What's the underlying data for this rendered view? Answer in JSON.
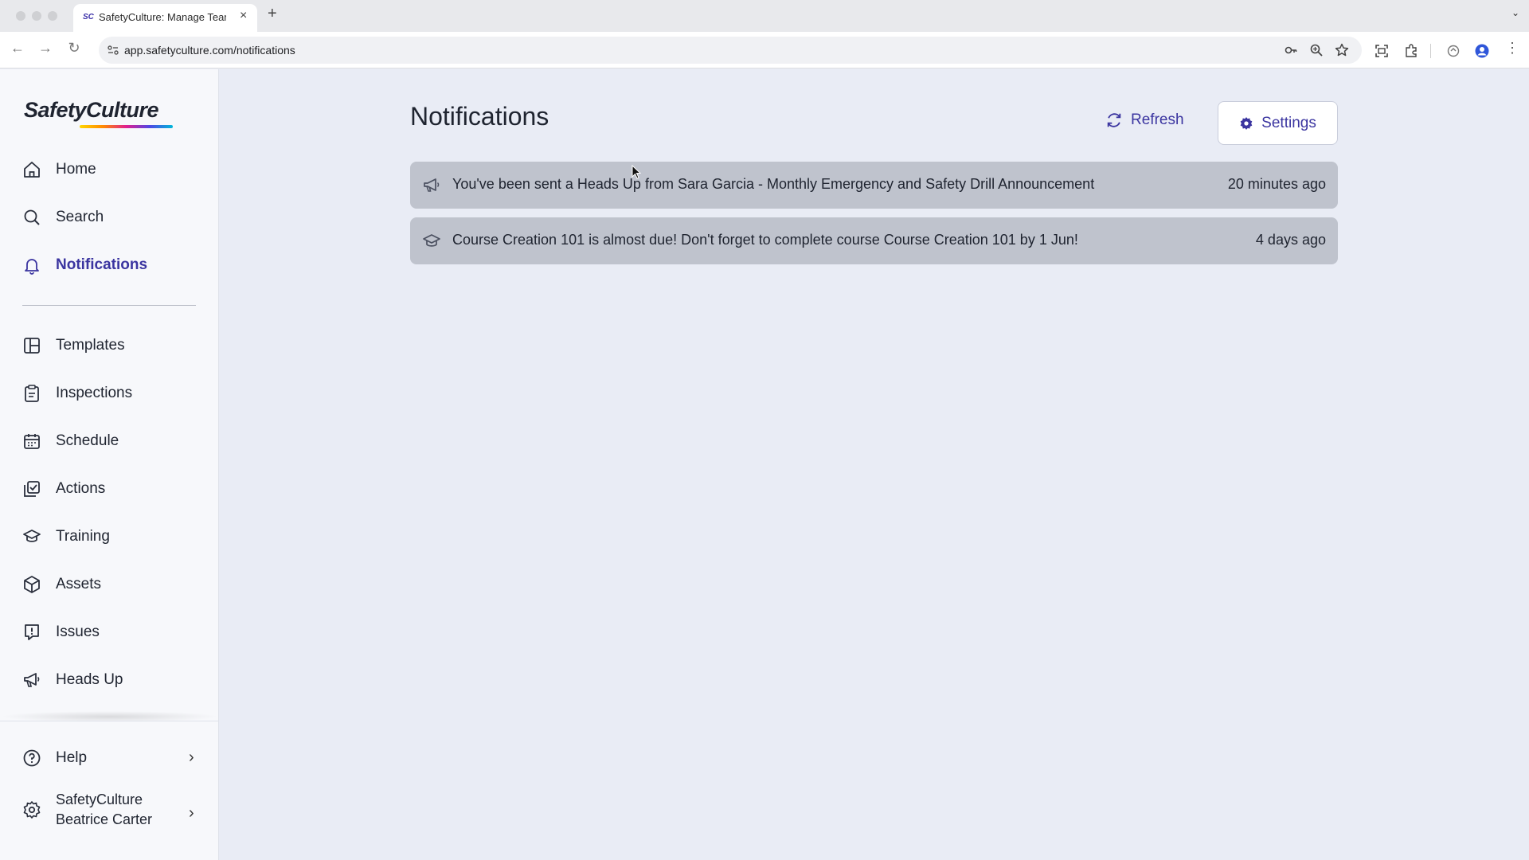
{
  "browser": {
    "tab_title": "SafetyCulture: Manage Teams",
    "tab_favicon": "SC",
    "url": "app.safetyculture.com/notifications"
  },
  "sidebar": {
    "logo": "SafetyCulture",
    "primary": [
      {
        "label": "Home",
        "icon": "home-icon"
      },
      {
        "label": "Search",
        "icon": "search-icon"
      },
      {
        "label": "Notifications",
        "icon": "bell-icon",
        "active": true
      }
    ],
    "secondary": [
      {
        "label": "Templates",
        "icon": "templates-icon"
      },
      {
        "label": "Inspections",
        "icon": "clipboard-icon"
      },
      {
        "label": "Schedule",
        "icon": "calendar-icon"
      },
      {
        "label": "Actions",
        "icon": "actions-icon"
      },
      {
        "label": "Training",
        "icon": "graduation-cap-icon"
      },
      {
        "label": "Assets",
        "icon": "cube-icon"
      },
      {
        "label": "Issues",
        "icon": "alert-icon"
      },
      {
        "label": "Heads Up",
        "icon": "megaphone-icon"
      }
    ],
    "help": {
      "label": "Help",
      "icon": "help-icon"
    },
    "account": {
      "org": "SafetyCulture",
      "user": "Beatrice Carter",
      "icon": "gear-icon"
    }
  },
  "main": {
    "title": "Notifications",
    "refresh_label": "Refresh",
    "settings_label": "Settings",
    "notifications": [
      {
        "icon": "megaphone-icon",
        "text": "You've been sent a Heads Up from Sara Garcia - Monthly Emergency and Safety Drill Announcement",
        "time": "20 minutes ago"
      },
      {
        "icon": "graduation-cap-icon",
        "text": "Course Creation 101 is almost due! Don't forget to complete course Course Creation 101 by 1 Jun!",
        "time": "4 days ago"
      }
    ]
  },
  "colors": {
    "accent": "#3b35a0",
    "sidebar_bg": "#f7f8fb",
    "main_bg": "#e9ecf5",
    "notification_bg": "#bfc3cd"
  }
}
